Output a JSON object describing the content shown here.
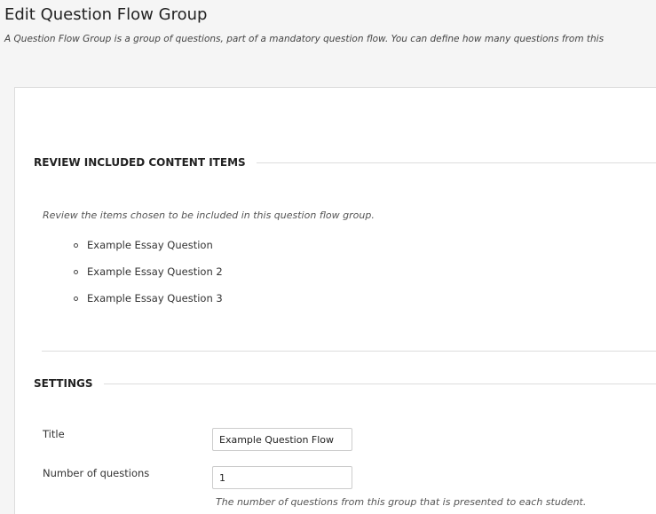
{
  "page": {
    "title": "Edit Question Flow Group",
    "description": "A Question Flow Group is a group of questions, part of a mandatory question flow. You can define how many questions from this"
  },
  "review_section": {
    "heading": "REVIEW INCLUDED CONTENT ITEMS",
    "instructions": "Review the items chosen to be included in this question flow group.",
    "items": [
      "Example Essay Question",
      "Example Essay Question 2",
      "Example Essay Question 3"
    ]
  },
  "settings_section": {
    "heading": "SETTINGS",
    "title_field": {
      "label": "Title",
      "value": "Example Question Flow"
    },
    "number_field": {
      "label": "Number of questions",
      "value": "1",
      "help": "The number of questions from this group that is presented to each student."
    }
  }
}
